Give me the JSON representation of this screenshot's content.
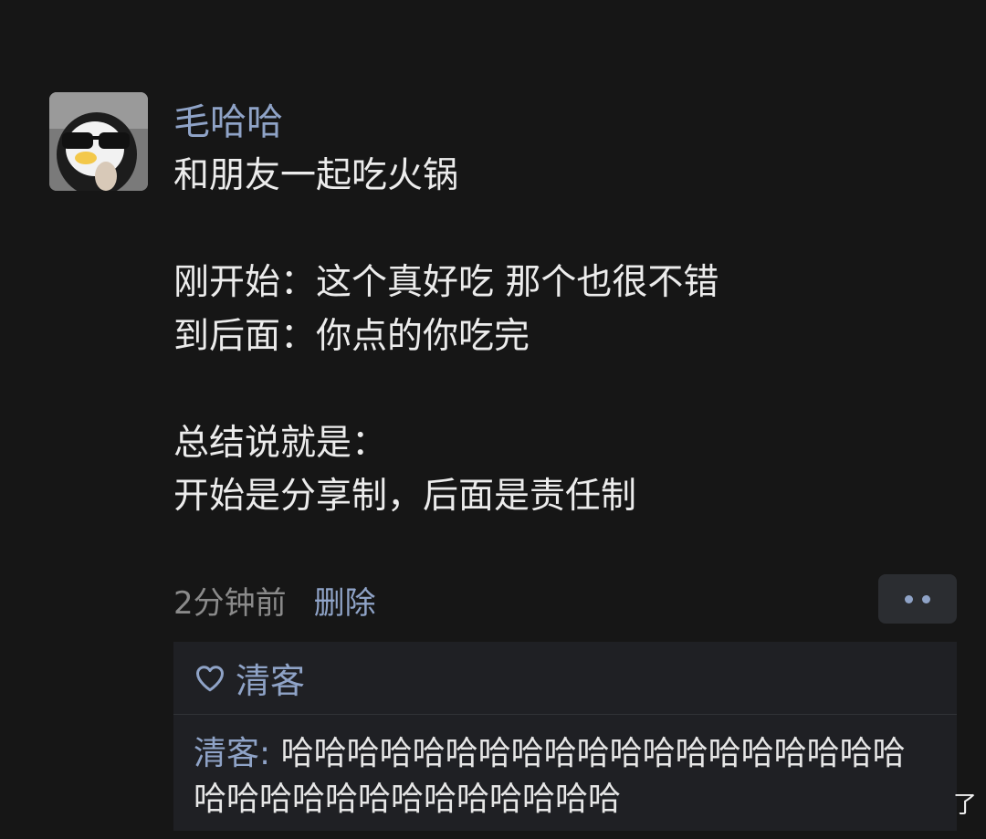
{
  "post": {
    "username": "毛哈哈",
    "lines": [
      "和朋友一起吃火锅",
      "",
      "刚开始：这个真好吃 那个也很不错",
      "到后面：你点的你吃完",
      "",
      "总结说就是：",
      "开始是分享制，后面是责任制"
    ],
    "time": "2分钟前",
    "delete_label": "删除",
    "avatar_icon": "penguin-sunglasses-avatar"
  },
  "likes": {
    "icon": "heart-icon",
    "liker": "清客"
  },
  "comment": {
    "author": "清客",
    "separator": ": ",
    "text": "哈哈哈哈哈哈哈哈哈哈哈哈哈哈哈哈哈哈哈哈哈哈哈哈哈哈哈哈哈哈哈哈"
  },
  "overlay": {
    "corner_char": "了"
  },
  "colors": {
    "background": "#161616",
    "accent": "#8fa3c7",
    "text": "#ececec",
    "muted": "#8a8a8a",
    "panel": "#1f2024"
  }
}
